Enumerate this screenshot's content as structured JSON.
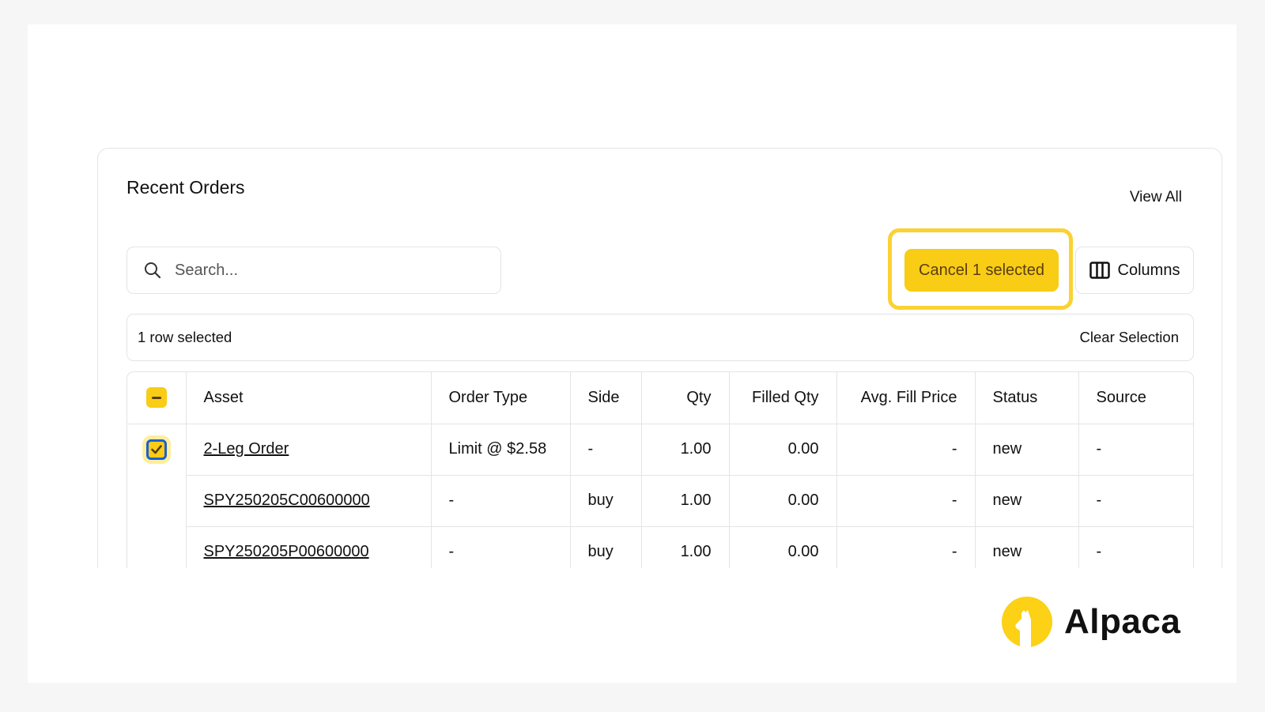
{
  "card": {
    "title": "Recent Orders",
    "view_all": "View All",
    "search_placeholder": "Search...",
    "cancel_button": "Cancel 1 selected",
    "columns_button": "Columns",
    "selection_text": "1 row selected",
    "clear_selection": "Clear Selection"
  },
  "table": {
    "headers": [
      "Asset",
      "Order Type",
      "Side",
      "Qty",
      "Filled Qty",
      "Avg. Fill Price",
      "Status",
      "Source"
    ],
    "rows": [
      {
        "asset": "2-Leg Order",
        "order_type": "Limit @ $2.58",
        "side": "-",
        "qty": "1.00",
        "filled_qty": "0.00",
        "avg_fill_price": "-",
        "status": "new",
        "source": "-",
        "selected": true
      },
      {
        "asset": "SPY250205C00600000",
        "order_type": "-",
        "side": "buy",
        "qty": "1.00",
        "filled_qty": "0.00",
        "avg_fill_price": "-",
        "status": "new",
        "source": "-"
      },
      {
        "asset": "SPY250205P00600000",
        "order_type": "-",
        "side": "buy",
        "qty": "1.00",
        "filled_qty": "0.00",
        "avg_fill_price": "-",
        "status": "new",
        "source": "-"
      }
    ]
  },
  "brand": {
    "name": "Alpaca",
    "color": "#fcd116"
  },
  "colors": {
    "accent": "#f9cc16",
    "highlight": "#fad232",
    "focus": "#1d5fd1"
  }
}
